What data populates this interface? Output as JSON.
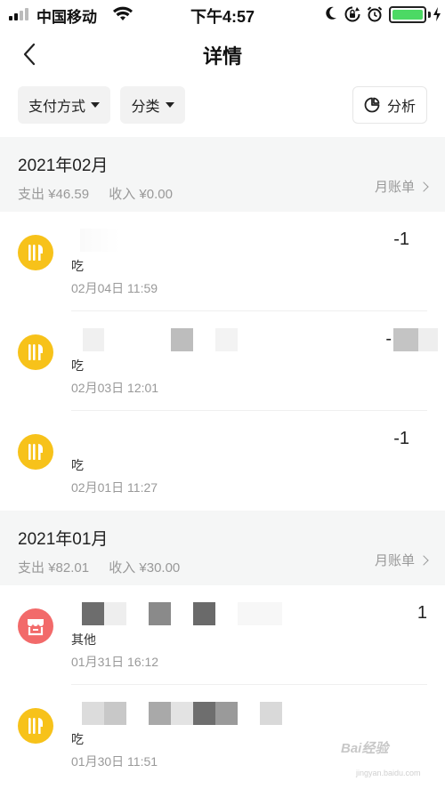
{
  "status_bar": {
    "carrier": "中国移动",
    "time": "下午4:57",
    "battery_level": 1.0,
    "icons": [
      "signal-icon",
      "wifi-icon",
      "moon-icon",
      "rotation-lock-icon",
      "alarm-icon",
      "battery-icon",
      "charging-icon"
    ]
  },
  "nav": {
    "title": "详情",
    "back_icon": "chevron-left-icon"
  },
  "filters": {
    "payment_label": "支付方式",
    "category_label": "分类",
    "analysis_label": "分析",
    "analysis_icon": "pie-chart-icon"
  },
  "months": [
    {
      "title": "2021年02月",
      "expense": "支出 ¥46.59",
      "income": "收入 ¥0.00",
      "bill_label": "月账单",
      "transactions": [
        {
          "category": "吃",
          "time": "02月04日 11:59",
          "amount": "-1",
          "icon": "utensils-icon",
          "color": "#f7c21a"
        },
        {
          "category": "吃",
          "time": "02月03日 12:01",
          "amount": "-",
          "icon": "utensils-icon",
          "color": "#f7c21a"
        },
        {
          "category": "吃",
          "time": "02月01日 11:27",
          "amount": "-1",
          "icon": "utensils-icon",
          "color": "#f7c21a"
        }
      ]
    },
    {
      "title": "2021年01月",
      "expense": "支出 ¥82.01",
      "income": "收入 ¥30.00",
      "bill_label": "月账单",
      "transactions": [
        {
          "category": "其他",
          "time": "01月31日 16:12",
          "amount": "1",
          "icon": "shop-icon",
          "color": "#f26a6a"
        },
        {
          "category": "吃",
          "time": "01月30日 11:51",
          "amount": "",
          "icon": "utensils-icon",
          "color": "#f7c21a"
        }
      ]
    }
  ],
  "watermark": {
    "text": "Bai经验",
    "subtext": "jingyan.baidu.com"
  }
}
